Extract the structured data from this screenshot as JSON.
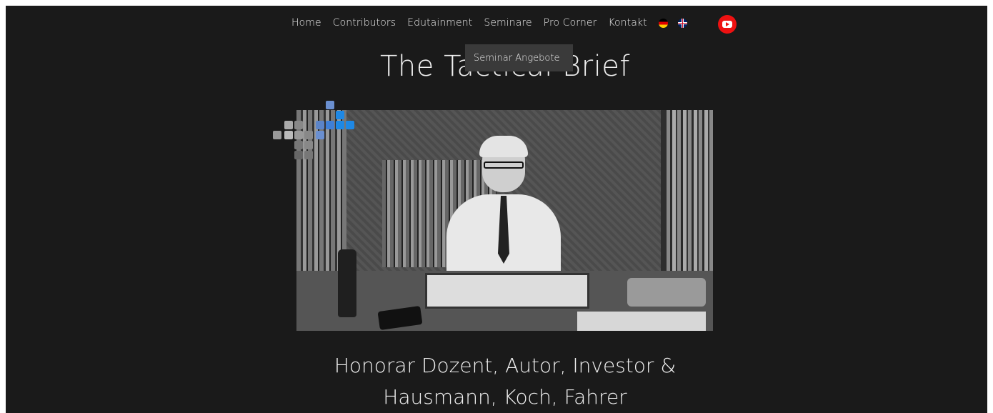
{
  "nav": {
    "items": [
      {
        "label": "Home"
      },
      {
        "label": "Contributors"
      },
      {
        "label": "Edutainment"
      },
      {
        "label": "Seminare"
      },
      {
        "label": "Pro Corner"
      },
      {
        "label": "Kontakt"
      }
    ],
    "dropdown": {
      "label": "Seminar Angebote"
    }
  },
  "hero": {
    "title": "The Tactical Brief",
    "caption_line1": "Honorar Dozent, Autor, Investor &",
    "caption_line2": "Hausmann, Koch, Fahrer"
  },
  "colors": {
    "background": "#1a1a1a",
    "youtube": "#ee1111",
    "accent_blue": "#1e88e5"
  },
  "icons": {
    "flag_de": "german-flag-icon",
    "flag_uk": "uk-flag-icon",
    "youtube": "youtube-icon"
  }
}
